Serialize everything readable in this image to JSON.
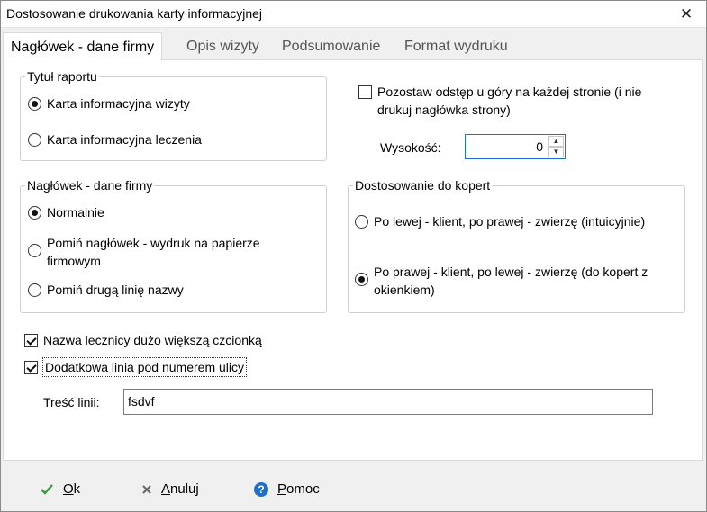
{
  "window": {
    "title": "Dostosowanie drukowania karty informacyjnej",
    "close_glyph": "✕"
  },
  "tabs": [
    {
      "label": "Nagłówek - dane firmy",
      "active": true
    },
    {
      "label": "Opis wizyty",
      "active": false
    },
    {
      "label": "Podsumowanie",
      "active": false
    },
    {
      "label": "Format wydruku",
      "active": false
    }
  ],
  "report_title": {
    "legend": "Tytuł raportu",
    "options": [
      {
        "label": "Karta informacyjna wizyty",
        "selected": true
      },
      {
        "label": "Karta informacyjna leczenia",
        "selected": false
      }
    ]
  },
  "top_spacing": {
    "checkbox_label": "Pozostaw odstęp u góry na każdej stronie (i nie drukuj nagłówka strony)",
    "line1": "Pozostaw odstęp u góry na każdej stronie (i nie",
    "line2": "drukuj nagłówka strony)",
    "checked": false,
    "height_label": "Wysokość:",
    "height_value": "0"
  },
  "company_header": {
    "legend": "Nagłówek - dane firmy",
    "options": [
      {
        "label": "Normalnie",
        "selected": true
      },
      {
        "line1": "Pomiń nagłówek - wydruk na papierze",
        "line2": "firmowym",
        "selected": false
      },
      {
        "label": "Pomiń drugą linię nazwy",
        "selected": false
      }
    ]
  },
  "envelopes": {
    "legend": "Dostosowanie do kopert",
    "options": [
      {
        "label": "Po lewej - klient, po prawej - zwierzę (intuicyjnie)",
        "selected": false
      },
      {
        "line1": "Po prawej - klient, po lewej - zwierzę (do kopert z",
        "line2": "okienkiem)",
        "selected": true
      }
    ]
  },
  "options": {
    "big_clinic_name": {
      "label": "Nazwa lecznicy dużo większą czcionką",
      "checked": true
    },
    "extra_line": {
      "label": "Dodatkowa linia pod numerem ulicy",
      "checked": true
    },
    "line_text_label": "Treść linii:",
    "line_text_value": "fsdvf"
  },
  "footer": {
    "ok": {
      "label": "Ok",
      "icon": "check-icon"
    },
    "cancel": {
      "label": "Anuluj",
      "icon": "x-icon"
    },
    "help": {
      "label": "Pomoc",
      "icon": "help-icon"
    }
  },
  "colors": {
    "accent": "#1f6fc5",
    "ok_green": "#3a9a3a",
    "cancel_gray": "#666666"
  }
}
